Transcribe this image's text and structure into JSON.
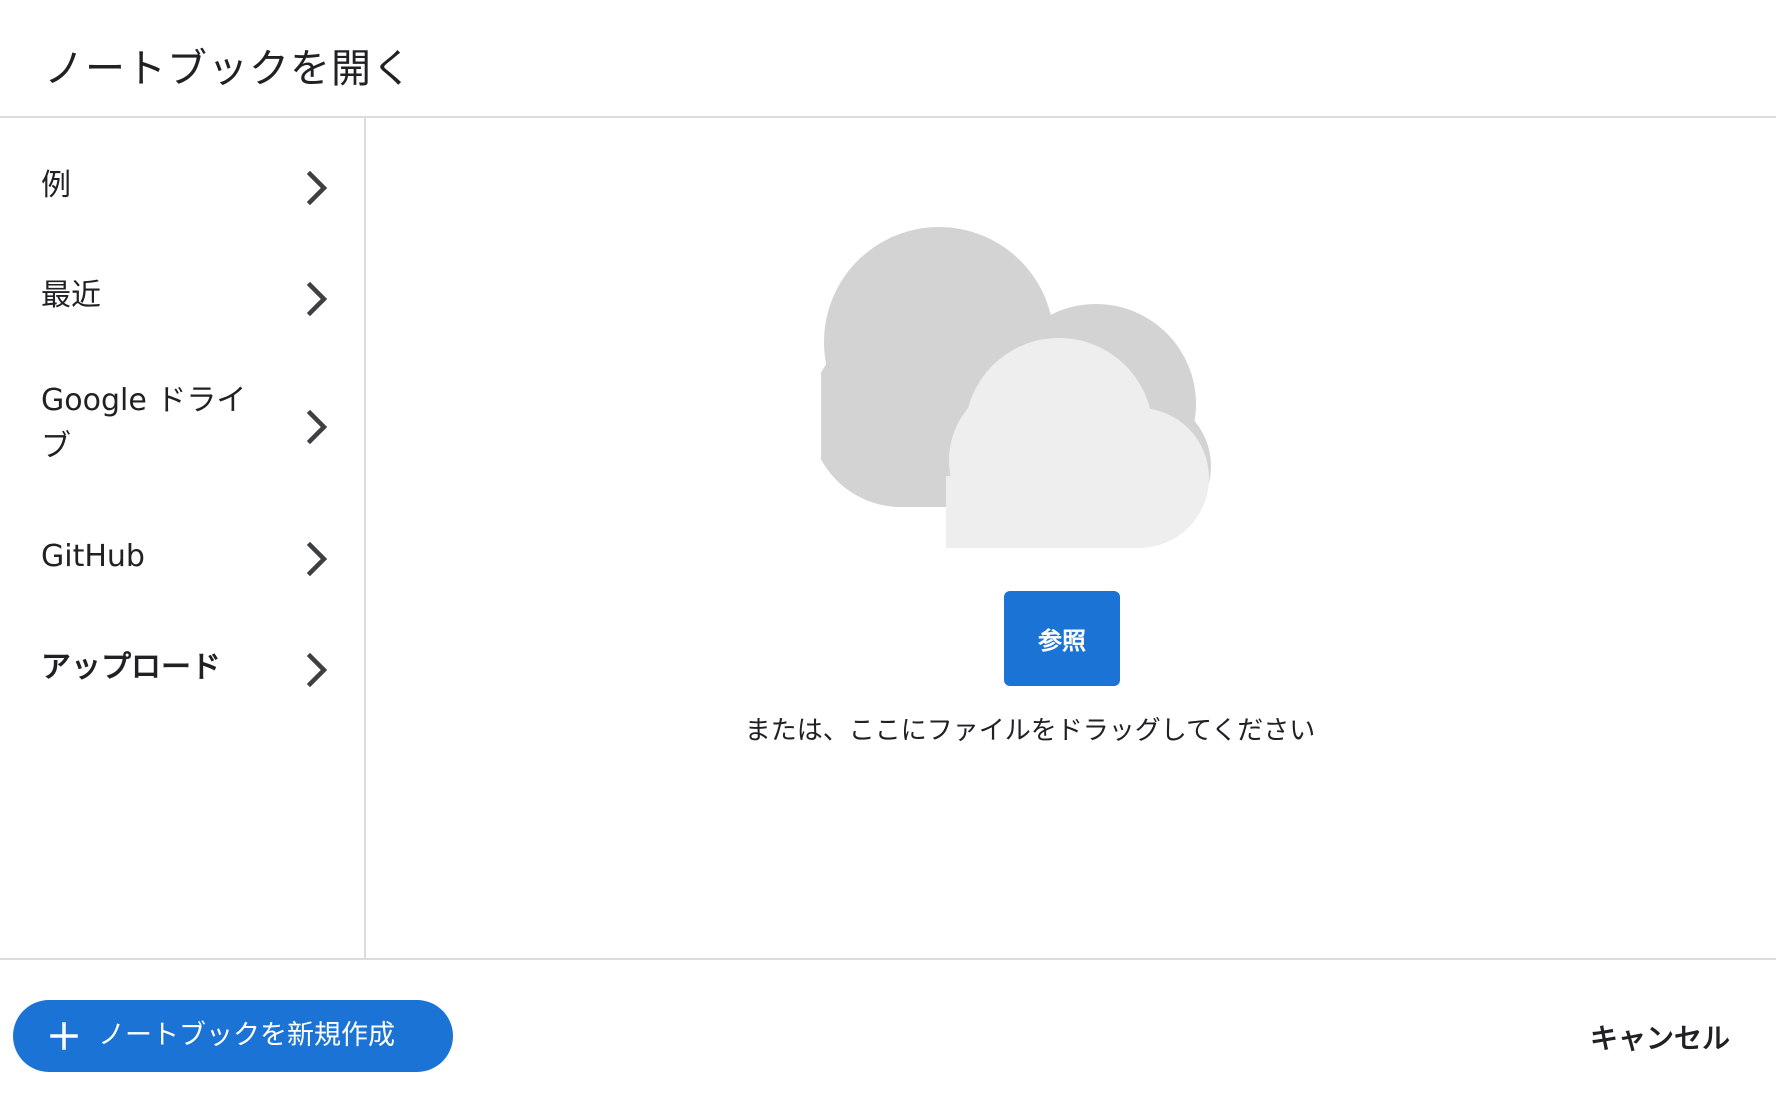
{
  "dialog": {
    "title": "ノートブックを開く"
  },
  "sidebar": {
    "items": [
      {
        "label": "例",
        "icon": "chevron-right-icon",
        "active": false
      },
      {
        "label": "最近",
        "icon": "chevron-right-icon",
        "active": false
      },
      {
        "label": "Google ドライブ",
        "icon": "chevron-right-icon",
        "active": false
      },
      {
        "label": "GitHub",
        "icon": "chevron-right-icon",
        "active": false
      },
      {
        "label": "アップロード",
        "icon": "chevron-right-icon",
        "active": true
      }
    ]
  },
  "upload": {
    "illustration": "cloud-icon",
    "browse_label": "参照",
    "drop_hint": "または、ここにファイルをドラッグしてください"
  },
  "footer": {
    "new_notebook_label": "ノートブックを新規作成",
    "new_notebook_icon": "plus-icon",
    "cancel_label": "キャンセル"
  },
  "colors": {
    "accent": "#1a73d5",
    "divider": "#dadce0",
    "cloud_back": "#d3d3d3",
    "cloud_front": "#eeeeee"
  }
}
